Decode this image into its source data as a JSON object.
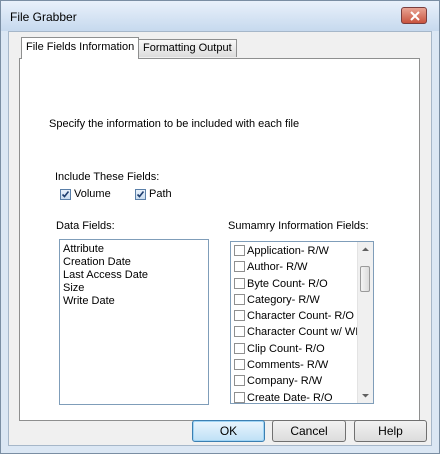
{
  "window": {
    "title": "File Grabber"
  },
  "tabs": [
    {
      "label": "File Fields  Information"
    },
    {
      "label": "Formatting Output"
    }
  ],
  "panel": {
    "instruction": "Specify the information to be included with each file",
    "include_label": "Include These Fields:",
    "include_fields": [
      {
        "label": "Volume",
        "checked": true
      },
      {
        "label": "Path",
        "checked": true
      }
    ],
    "data_fields_label": "Data Fields:",
    "data_fields": [
      "Attribute",
      "Creation Date",
      "Last Access Date",
      "Size",
      "Write Date"
    ],
    "summary_label": "Sumamry Information Fields:",
    "summary_fields": [
      {
        "label": "Application- R/W",
        "checked": false
      },
      {
        "label": "Author- R/W",
        "checked": false
      },
      {
        "label": "Byte Count- R/O",
        "checked": false
      },
      {
        "label": "Category- R/W",
        "checked": false
      },
      {
        "label": "Character Count- R/O",
        "checked": false
      },
      {
        "label": "Character Count w/ WI",
        "checked": false
      },
      {
        "label": "Clip Count- R/O",
        "checked": false
      },
      {
        "label": "Comments- R/W",
        "checked": false
      },
      {
        "label": "Company- R/W",
        "checked": false
      },
      {
        "label": "Create Date- R/O",
        "checked": false
      }
    ]
  },
  "buttons": {
    "ok": "OK",
    "cancel": "Cancel",
    "help": "Help"
  },
  "icons": {
    "close": "close-icon",
    "check": "check-icon",
    "scroll_up": "scroll-up-arrow-icon",
    "scroll_down": "scroll-down-arrow-icon"
  },
  "colors": {
    "accent": "#3c7fb1",
    "close_button": "#c9543f"
  }
}
